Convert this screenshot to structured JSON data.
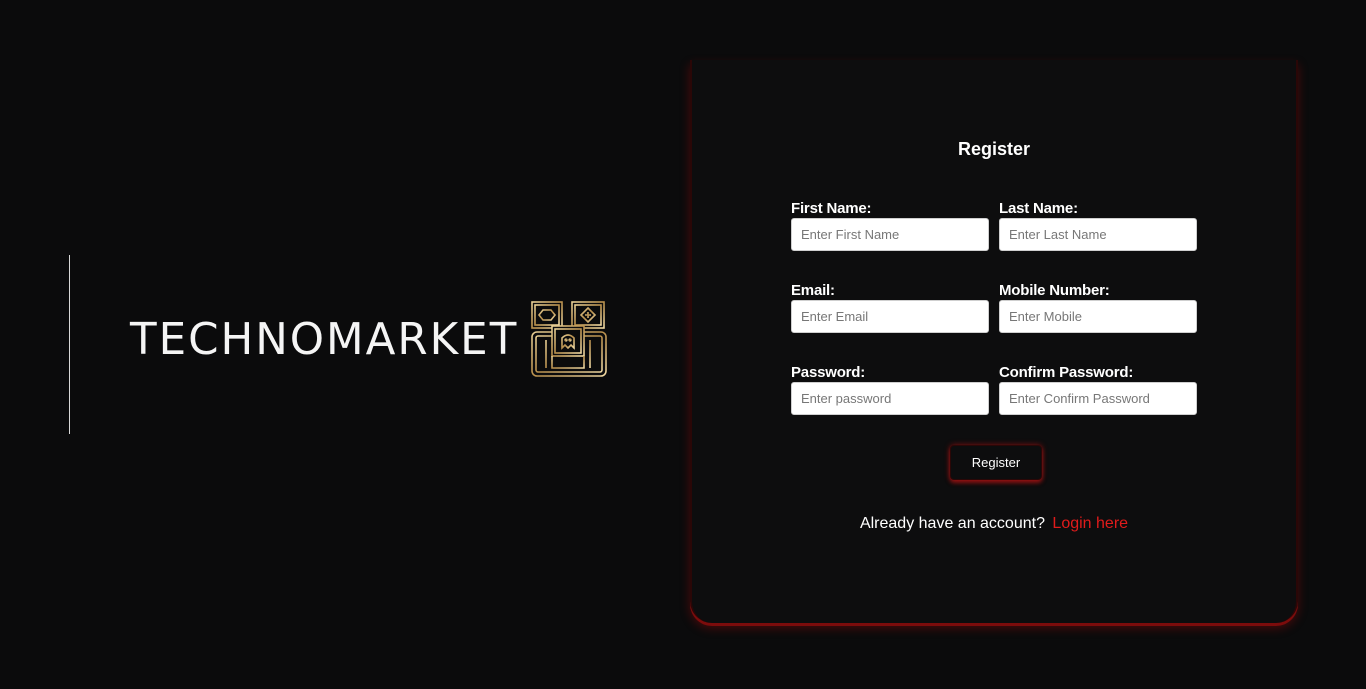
{
  "brand": {
    "name": "TECHNOMARKET",
    "logo_icon": "gaming-device-icon",
    "logo_color": "#c9a86a"
  },
  "register_form": {
    "title": "Register",
    "fields": {
      "first_name": {
        "label": "First Name:",
        "placeholder": "Enter First Name",
        "value": ""
      },
      "last_name": {
        "label": "Last Name:",
        "placeholder": "Enter Last Name",
        "value": ""
      },
      "email": {
        "label": "Email:",
        "placeholder": "Enter Email",
        "value": ""
      },
      "mobile": {
        "label": "Mobile Number:",
        "placeholder": "Enter Mobile",
        "value": ""
      },
      "password": {
        "label": "Password:",
        "placeholder": "Enter password",
        "value": ""
      },
      "confirm_password": {
        "label": "Confirm Password:",
        "placeholder": "Enter Confirm Password",
        "value": ""
      }
    },
    "submit_label": "Register",
    "login_prompt": "Already have an account?",
    "login_link": "Login here"
  },
  "colors": {
    "background": "#0b0b0c",
    "accent": "#e01b1b",
    "glow": "#7c0c0c"
  }
}
